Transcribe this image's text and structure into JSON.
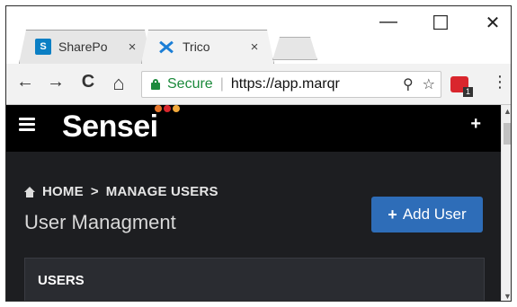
{
  "browser": {
    "tabs": [
      {
        "title": "SharePo",
        "icon": "sharepoint-icon",
        "icon_text": "S"
      },
      {
        "title": "Trico",
        "icon": "trico-icon"
      }
    ],
    "close_glyph": "×",
    "window_controls": {
      "minimize": "—",
      "maximize": "☐",
      "close": "✕"
    },
    "nav": {
      "back": "←",
      "forward": "→",
      "reload": "C",
      "home": "⌂"
    },
    "address": {
      "secure_label": "Secure",
      "separator": "|",
      "url": "https://app.marqr"
    },
    "omnibox_icons": {
      "key": "⚲",
      "star": "☆"
    },
    "extension_badge": "1",
    "menu_glyph": "⋮"
  },
  "app": {
    "logo": "Sensei",
    "logo_dot_colors": [
      "#e8762c",
      "#d9262d",
      "#f2a93b"
    ],
    "top_plus": "+",
    "breadcrumb": {
      "home": "HOME",
      "separator": ">",
      "current": "MANAGE USERS"
    },
    "page_title": "User Managment",
    "add_button": {
      "icon": "+",
      "label": "Add User"
    },
    "users_panel": {
      "heading": "USERS"
    }
  },
  "colors": {
    "accent": "#2e6db8",
    "secure": "#1c8a3c",
    "page_bg": "#1d1e21",
    "appbar_bg": "#000000"
  }
}
